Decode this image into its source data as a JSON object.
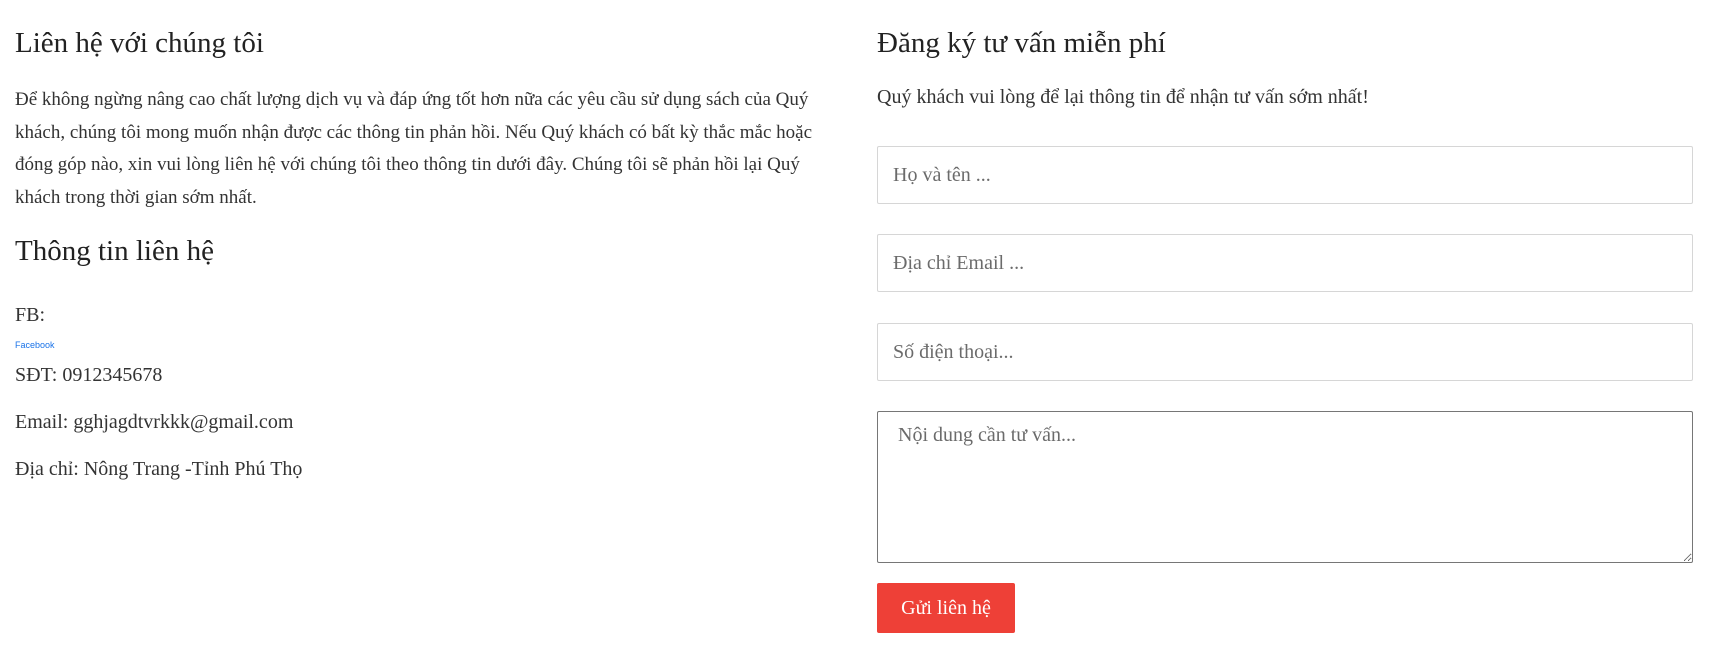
{
  "contact_intro": {
    "title": "Liên hệ với chúng tôi",
    "text": "Để không ngừng nâng cao chất lượng dịch vụ và đáp ứng tốt hơn nữa các yêu cầu sử dụng sách của Quý khách, chúng tôi mong muốn nhận được các thông tin phản hồi. Nếu Quý khách có bất kỳ thắc mắc hoặc đóng góp nào, xin vui lòng liên hệ với chúng tôi theo thông tin dưới đây. Chúng tôi sẽ phản hồi lại Quý khách trong thời gian sớm nhất."
  },
  "contact_info": {
    "title": "Thông tin liên hệ",
    "fb_label": "FB:",
    "fb_link_text": "Facebook",
    "phone": "SĐT: 0912345678",
    "email": "Email: gghjagdtvrkkk@gmail.com",
    "address": "Địa chỉ: Nông Trang -Tỉnh Phú Thọ"
  },
  "form": {
    "title": "Đăng ký tư vấn miễn phí",
    "subtitle": "Quý khách vui lòng để lại thông tin để nhận tư vấn sớm nhất!",
    "name_placeholder": "Họ và tên ...",
    "email_placeholder": "Địa chỉ Email ...",
    "phone_placeholder": "Số điện thoại...",
    "message_placeholder": "Nội dung cần tư vấn...",
    "submit_label": "Gửi liên hệ"
  },
  "colors": {
    "submit_bg": "#ee4037",
    "link": "#1a73e8"
  }
}
